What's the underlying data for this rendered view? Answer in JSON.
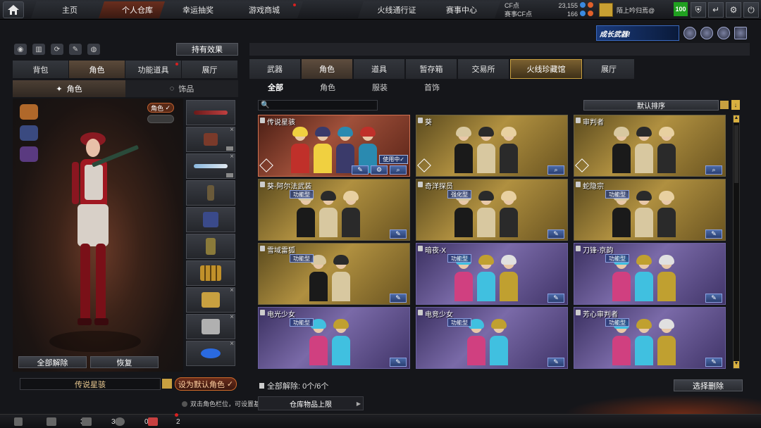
{
  "topnav": {
    "tabs": [
      {
        "label": "主页",
        "active": false,
        "dot": false
      },
      {
        "label": "个人仓库",
        "active": true,
        "dot": false
      },
      {
        "label": "幸运抽奖",
        "active": false,
        "dot": false
      },
      {
        "label": "游戏商城",
        "active": false,
        "dot": true
      },
      {
        "label": "火线通行证",
        "active": false,
        "dot": false
      },
      {
        "label": "赛事中心",
        "active": false,
        "dot": false
      }
    ],
    "cf_label": "CF点",
    "cf_value": "23,155",
    "event_cf_label": "赛事CF点",
    "event_cf_value": "166",
    "username": "陌上吟归焉@",
    "level": "100"
  },
  "banner": {
    "text": "成长武器!"
  },
  "left": {
    "effects_button": "持有效果",
    "tabs": [
      {
        "label": "背包",
        "active": false
      },
      {
        "label": "角色",
        "active": true
      },
      {
        "label": "功能道具",
        "active": false
      },
      {
        "label": "展厅",
        "active": false
      }
    ],
    "subtabs": [
      {
        "label": "角色",
        "active": true
      },
      {
        "label": "饰品",
        "active": false
      }
    ],
    "toggle_label": "角色",
    "unequip_all": "全部解除",
    "restore": "恢复",
    "character_name": "传说星骇",
    "set_default": "设为默认角色"
  },
  "right": {
    "main_tabs": [
      {
        "label": "武器",
        "style": "normal"
      },
      {
        "label": "角色",
        "style": "active"
      },
      {
        "label": "道具",
        "style": "normal"
      },
      {
        "label": "暂存箱",
        "style": "normal"
      },
      {
        "label": "交易所",
        "style": "normal"
      },
      {
        "label": "火线珍藏馆",
        "style": "gold"
      },
      {
        "label": "展厅",
        "style": "normal"
      }
    ],
    "filter_tabs": [
      {
        "label": "全部",
        "active": true
      },
      {
        "label": "角色",
        "active": false
      },
      {
        "label": "服装",
        "active": false
      },
      {
        "label": "首饰",
        "active": false
      }
    ],
    "sort_label": "默认排序",
    "cards": [
      {
        "name": "传说星骇",
        "theme": "red",
        "tag": "",
        "in_use": "使用中✓",
        "buttons": 3
      },
      {
        "name": "葵",
        "theme": "gold",
        "tag": "",
        "in_use": "",
        "buttons": 1
      },
      {
        "name": "审判者",
        "theme": "gold",
        "tag": "",
        "in_use": "",
        "buttons": 1
      },
      {
        "name": "葵-阿尔法武装",
        "theme": "gold",
        "tag": "功能型",
        "in_use": "",
        "buttons": 1
      },
      {
        "name": "奇洋探员",
        "theme": "gold",
        "tag": "强化型",
        "in_use": "",
        "buttons": 1
      },
      {
        "name": "蛇隐宗",
        "theme": "gold",
        "tag": "功能型",
        "in_use": "",
        "buttons": 1
      },
      {
        "name": "雪域雷狐",
        "theme": "gold",
        "tag": "功能型",
        "in_use": "",
        "buttons": 1
      },
      {
        "name": "暗夜-X",
        "theme": "purple",
        "tag": "功能型",
        "in_use": "",
        "buttons": 1
      },
      {
        "name": "刀锋-京韵",
        "theme": "purple",
        "tag": "功能型",
        "in_use": "",
        "buttons": 1
      },
      {
        "name": "电光少女",
        "theme": "purple",
        "tag": "功能型",
        "in_use": "",
        "buttons": 1
      },
      {
        "name": "电竞少女",
        "theme": "purple",
        "tag": "功能型",
        "in_use": "",
        "buttons": 1
      },
      {
        "name": "芳心审判者",
        "theme": "purple",
        "tag": "功能型",
        "in_use": "",
        "buttons": 1
      }
    ],
    "unequip_count": "全部解除: 0个/6个",
    "batch_delete": "选择删除"
  },
  "bottom": {
    "tip": "双击角色栏位，可设置基本",
    "storage_limit": "仓库物品上限",
    "counts": [
      "3",
      "3",
      "0",
      "2"
    ]
  },
  "colors": {
    "accent_gold": "#c8a040",
    "active_tab": "#6a2e1e",
    "level_green": "#20a020",
    "notify_red": "#d82020"
  }
}
